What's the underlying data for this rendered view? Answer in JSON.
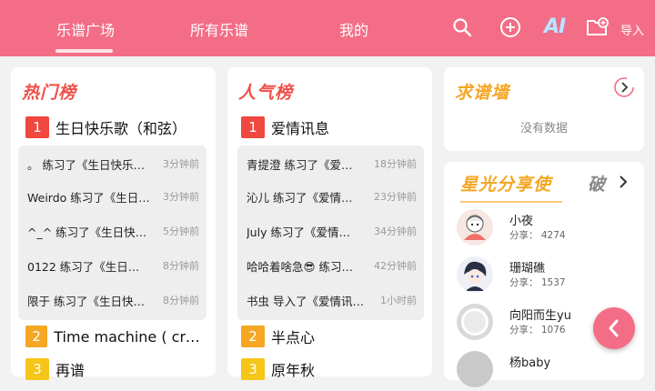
{
  "header": {
    "tabs": [
      {
        "label": "乐谱广场",
        "active": true
      },
      {
        "label": "所有乐谱",
        "active": false
      },
      {
        "label": "我的",
        "active": false
      }
    ],
    "ai_label": "AI",
    "import_label": "导入",
    "icons": [
      "search-icon",
      "add-circle-icon",
      "ai-icon",
      "folder-add-icon"
    ],
    "accent": "#f46d86"
  },
  "hot": {
    "title": "热门榜",
    "title_color": "#f0504a",
    "top": {
      "rank": "1",
      "title": "生日快乐歌（和弦）"
    },
    "activity": [
      {
        "text": "。 练习了《生日快乐…",
        "time": "3分钟前"
      },
      {
        "text": "Weirdo 练习了《生日…",
        "time": "3分钟前"
      },
      {
        "text": "^_^ 练习了《生日快…",
        "time": "5分钟前"
      },
      {
        "text": "0122 练习了《生日…",
        "time": "8分钟前"
      },
      {
        "text": "限于 练习了《生日快…",
        "time": "8分钟前"
      }
    ],
    "ranks": [
      {
        "rank": "2",
        "title": "Time machine ( cre: …"
      },
      {
        "rank": "3",
        "title": "再谱"
      }
    ]
  },
  "popular": {
    "title": "人气榜",
    "title_color": "#f0504a",
    "top": {
      "rank": "1",
      "title": "爱情讯息"
    },
    "activity": [
      {
        "text": "青提澄 练习了《爱…",
        "time": "18分钟前"
      },
      {
        "text": "沁儿 练习了《爱情…",
        "time": "23分钟前"
      },
      {
        "text": "July 练习了《爱情…",
        "time": "34分钟前"
      },
      {
        "text": "哈哈着啥急😎 练习…",
        "time": "42分钟前"
      },
      {
        "text": "书虫 导入了《爱情讯…",
        "time": "1小时前"
      }
    ],
    "ranks": [
      {
        "rank": "2",
        "title": "半点心"
      },
      {
        "rank": "3",
        "title": "原年秋"
      }
    ]
  },
  "requests": {
    "title": "求谱墙",
    "title_color": "#f5a623",
    "empty_text": "没有数据"
  },
  "stars": {
    "title": "星光分享使",
    "title_color": "#f5a623",
    "side_text": "破",
    "users": [
      {
        "name": "小夜",
        "count": "分享： 4274"
      },
      {
        "name": "珊瑚礁",
        "count": "分享： 1537"
      },
      {
        "name": "向阳而生yu",
        "count": "分享： 1076"
      },
      {
        "name": "杨baby",
        "count": ""
      }
    ]
  }
}
